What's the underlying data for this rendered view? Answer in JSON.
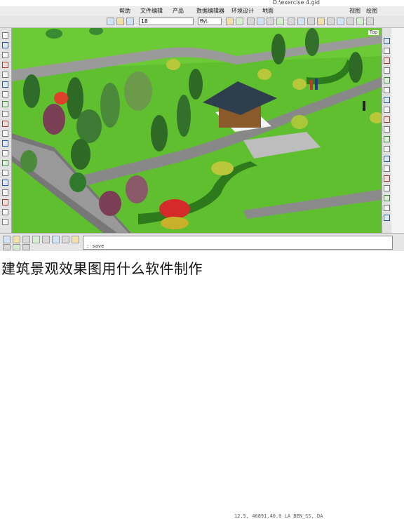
{
  "window": {
    "title": "D:\\exercise 4.gid"
  },
  "menu": {
    "items": [
      "帮助",
      "文件编辑",
      "产品",
      "数据编辑器",
      "环境设计",
      "地面",
      "视图",
      "绘图"
    ]
  },
  "toolbar": {
    "layer_value": "18",
    "color_label": "ByL"
  },
  "viewport": {
    "label": "Top"
  },
  "command_line": {
    "text": ": save"
  },
  "status": {
    "coords": "12.5, 46891.40.0 LA BEN_SS, DA"
  },
  "caption": "建筑景观效果图用什么软件制作"
}
